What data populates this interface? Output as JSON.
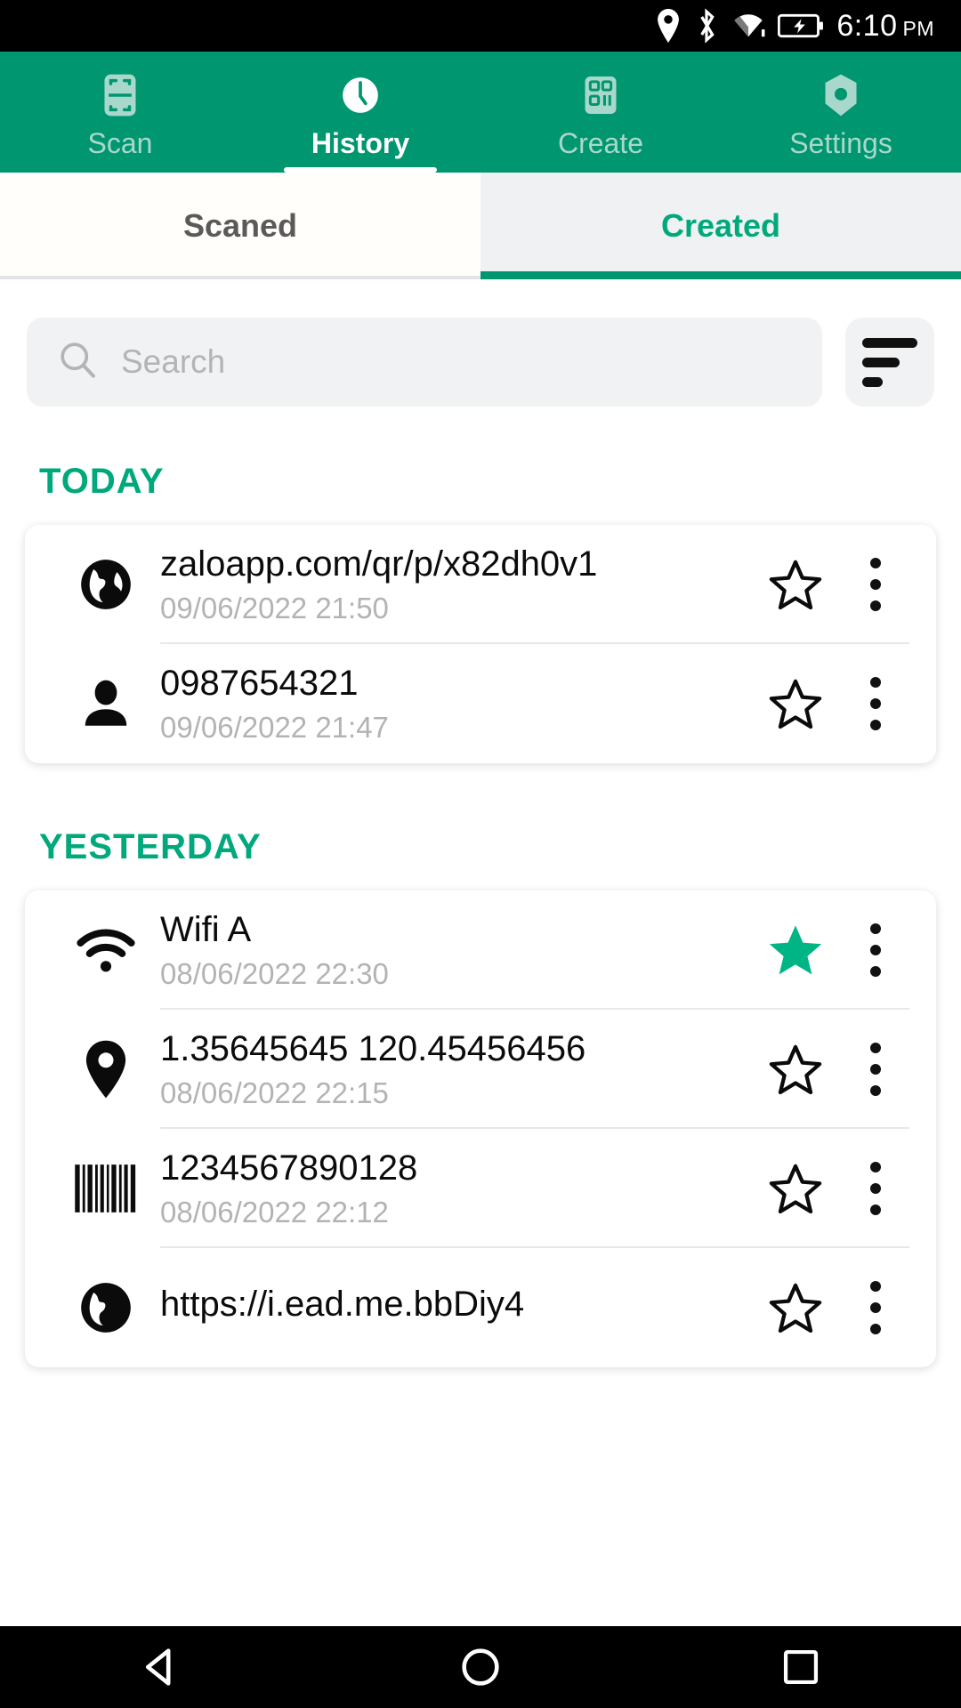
{
  "status_bar": {
    "time": "6:10",
    "ampm": "PM",
    "icons": [
      "location-icon",
      "bluetooth-icon",
      "wifi-icon",
      "battery-charging-icon"
    ]
  },
  "top_nav": {
    "tabs": [
      {
        "label": "Scan",
        "icon": "scan-frame-icon",
        "active": false
      },
      {
        "label": "History",
        "icon": "clock-icon",
        "active": true
      },
      {
        "label": "Create",
        "icon": "qr-create-icon",
        "active": false
      },
      {
        "label": "Settings",
        "icon": "gear-hex-icon",
        "active": false
      }
    ]
  },
  "sub_tabs": {
    "scanned_label": "Scaned",
    "created_label": "Created",
    "active": "Created"
  },
  "search": {
    "placeholder": "Search",
    "value": "",
    "icon": "search-icon",
    "sort_icon": "sort-lines-icon"
  },
  "sections": [
    {
      "title": "TODAY",
      "items": [
        {
          "icon": "globe-icon",
          "title": "zaloapp.com/qr/p/x82dh0v1",
          "date": "09/06/2022  21:50",
          "starred": false
        },
        {
          "icon": "person-icon",
          "title": "0987654321",
          "date": "09/06/2022  21:47",
          "starred": false
        }
      ]
    },
    {
      "title": "YESTERDAY",
      "items": [
        {
          "icon": "wifi-icon",
          "title": "Wifi A",
          "date": "08/06/2022  22:30",
          "starred": true
        },
        {
          "icon": "location-pin-icon",
          "title": "1.35645645 120.45456456",
          "date": "08/06/2022  22:15",
          "starred": false
        },
        {
          "icon": "barcode-icon",
          "title": "1234567890128",
          "date": "08/06/2022  22:12",
          "starred": false
        },
        {
          "icon": "globe-icon",
          "title": "https://i.ead.me.bbDiy4",
          "date": "",
          "starred": false
        }
      ]
    }
  ],
  "colors": {
    "brand_green": "#009670",
    "accent_green": "#00a97c",
    "star_green": "#00b585",
    "inactive_tab": "#a8d8cb"
  },
  "bottom_nav": {
    "items": [
      "back-triangle-icon",
      "home-circle-icon",
      "recents-square-icon"
    ]
  }
}
